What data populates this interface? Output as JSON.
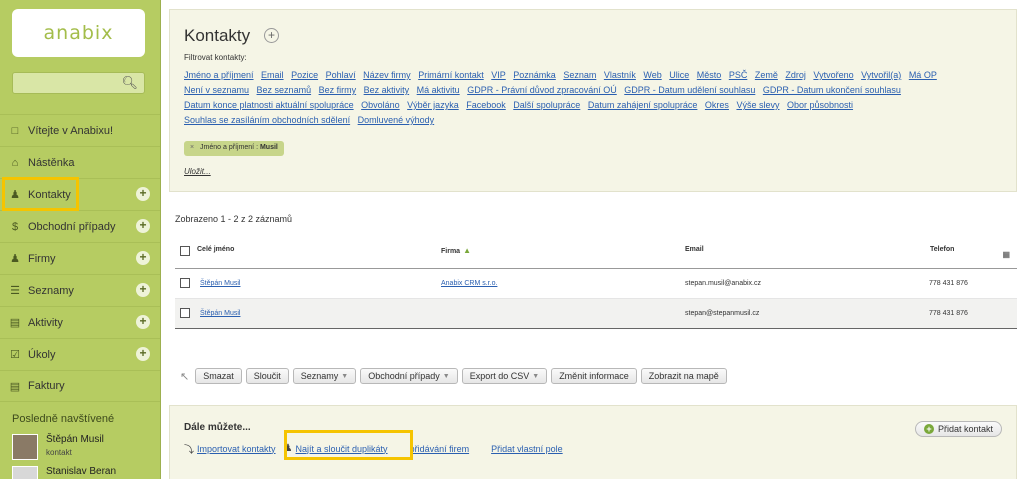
{
  "sidebar": {
    "logo": "anabix",
    "search": {
      "value": "",
      "placeholder": ""
    },
    "items": [
      {
        "label": "Vítejte v Anabixu!",
        "icon": "chat-icon",
        "plus": false
      },
      {
        "label": "Nástěnka",
        "icon": "home-icon",
        "plus": false
      },
      {
        "label": "Kontakty",
        "icon": "contact-icon",
        "plus": true
      },
      {
        "label": "Obchodní případy",
        "icon": "dollar-icon",
        "plus": true
      },
      {
        "label": "Firmy",
        "icon": "people-icon",
        "plus": true
      },
      {
        "label": "Seznamy",
        "icon": "list-icon",
        "plus": true
      },
      {
        "label": "Aktivity",
        "icon": "clipboard-icon",
        "plus": true
      },
      {
        "label": "Úkoly",
        "icon": "check-icon",
        "plus": true
      },
      {
        "label": "Faktury",
        "icon": "invoice-icon",
        "plus": false
      }
    ],
    "recent_title": "Posledně navštívené",
    "recent": [
      {
        "name": "Štěpán Musil",
        "sub": "kontakt"
      },
      {
        "name": "Stanislav Beran",
        "sub": ""
      }
    ]
  },
  "header": {
    "title": "Kontakty",
    "filter_label": "Filtrovat kontakty:",
    "filter_links": [
      "Jméno a příjmení",
      "Email",
      "Pozice",
      "Pohlaví",
      "Název firmy",
      "Primární kontakt",
      "VIP",
      "Poznámka",
      "Seznam",
      "Vlastník",
      "Web",
      "Ulice",
      "Město",
      "PSČ",
      "Země",
      "Zdroj",
      "Vytvořeno",
      "Vytvořil(a)",
      "Má OP",
      "Není v seznamu",
      "Bez seznamů",
      "Bez firmy",
      "Bez aktivity",
      "Má aktivitu",
      "GDPR - Právní důvod zpracování OÚ",
      "GDPR - Datum udělení souhlasu",
      "GDPR - Datum ukončení souhlasu",
      "Datum konce platnosti aktuální spolupráce",
      "Obvoláno",
      "Výběr jazyka",
      "Facebook",
      "Další spolupráce",
      "Datum zahájení spolupráce",
      "Okres",
      "Výše slevy",
      "Obor působnosti",
      "Souhlas se zasíláním obchodních sdělení",
      "Domluvené výhody"
    ],
    "active_filter": "Jméno a příjmení : ",
    "active_filter_value": "Musil",
    "save_label": "Uložit..."
  },
  "table": {
    "count_text": "Zobrazeno 1 - 2 z 2 záznamů",
    "columns": {
      "name": "Celé jméno",
      "company": "Firma",
      "email": "Email",
      "phone": "Telefon"
    },
    "rows": [
      {
        "name": "Štěpán Musil",
        "company": "Anabix CRM s.r.o.",
        "email": "stepan.musil@anabix.cz",
        "phone": "778 431 876"
      },
      {
        "name": "Štěpán Musil",
        "company": "",
        "email": "stepan@stepanmusil.cz",
        "phone": "778 431 876"
      }
    ]
  },
  "actions": {
    "delete": "Smazat",
    "merge": "Sloučit",
    "lists": "Seznamy",
    "deals": "Obchodní případy",
    "export": "Export do CSV",
    "change": "Změnit informace",
    "map": "Zobrazit na mapě"
  },
  "more": {
    "title": "Dále můžete...",
    "import": "Importovat kontakty",
    "duplicates": "Najít a sloučit duplikáty",
    "add_companies": "přidávání firem",
    "custom_field": "Přidat vlastní pole",
    "add_contact": "Přidat kontakt"
  },
  "colors": {
    "sidebar": "#b6cc62",
    "highlight": "#f5c400",
    "link": "#2a5fb0"
  }
}
